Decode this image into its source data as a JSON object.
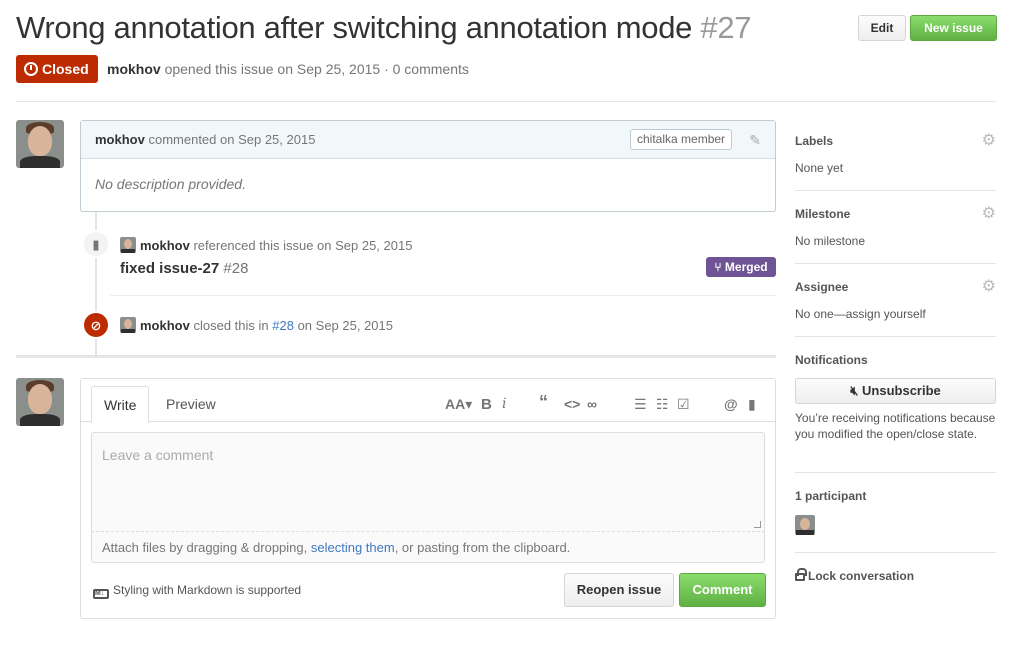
{
  "issue": {
    "title": "Wrong annotation after switching annotation mode",
    "number": "#27",
    "state": "Closed",
    "author": "mokhov",
    "opened_text": "opened this issue on Sep 25, 2015 · 0 comments"
  },
  "header_buttons": {
    "edit": "Edit",
    "new_issue": "New issue"
  },
  "comment": {
    "author": "mokhov",
    "action": "commented on Sep 25, 2015",
    "badge": "chitalka member",
    "body": "No description provided."
  },
  "events": {
    "reference": {
      "author": "mokhov",
      "action": "referenced this issue on Sep 25, 2015",
      "title": "fixed issue-27",
      "number": "#28",
      "badge": "Merged"
    },
    "closed": {
      "author": "mokhov",
      "action": "closed this in",
      "link": "#28",
      "date": "on Sep 25, 2015"
    }
  },
  "editor": {
    "tab_write": "Write",
    "tab_preview": "Preview",
    "placeholder": "Leave a comment",
    "attach_before": "Attach files by dragging & dropping,",
    "attach_link": "selecting them",
    "attach_after": ", or pasting from the clipboard.",
    "markdown_note": "Styling with Markdown is supported",
    "reopen": "Reopen issue",
    "comment": "Comment"
  },
  "sidebar": {
    "labels_title": "Labels",
    "labels_value": "None yet",
    "milestone_title": "Milestone",
    "milestone_value": "No milestone",
    "assignee_title": "Assignee",
    "assignee_value": "No one—assign yourself",
    "notifications_title": "Notifications",
    "unsubscribe": "Unsubscribe",
    "notifications_text": "You’re receiving notifications because you modified the open/close state.",
    "participants": "1 participant",
    "lock": "Lock conversation"
  },
  "colors": {
    "closed": "#bd2c00",
    "merged": "#6e5494",
    "primary_green": "#60b044",
    "link": "#4078c0"
  }
}
